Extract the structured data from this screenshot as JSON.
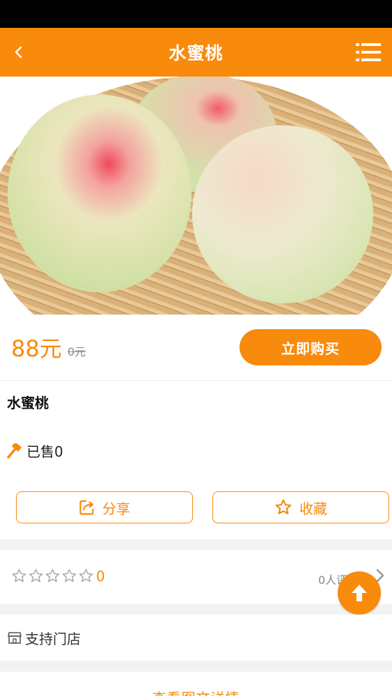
{
  "nav": {
    "title": "水蜜桃"
  },
  "product": {
    "price": "88元",
    "original_price": "0元",
    "buy_label": "立即购买",
    "name": "水蜜桃",
    "sold": "已售0"
  },
  "actions": {
    "share_label": "分享",
    "favorite_label": "收藏"
  },
  "rating": {
    "score": "0",
    "stars_filled": 0,
    "stars_total": 5,
    "reviews": "0人评"
  },
  "store": {
    "label": "支持门店"
  },
  "detail": {
    "label": "查看图文详情"
  },
  "colors": {
    "accent": "#f88a0c",
    "status_bar": "#000000"
  },
  "icons": [
    "back-arrow-icon",
    "menu-list-icon",
    "hammer-icon",
    "share-icon",
    "star-outline-icon",
    "chevron-right-icon",
    "arrow-up-icon",
    "store-icon"
  ]
}
